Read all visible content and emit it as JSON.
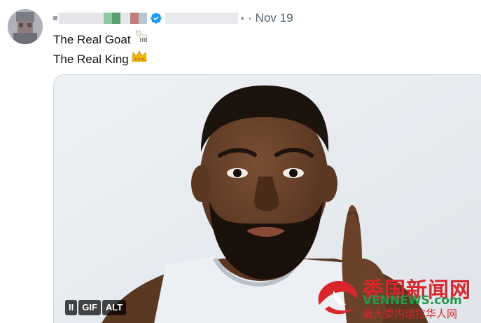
{
  "tweet": {
    "date_separator": "·",
    "date": "Nov 19",
    "lines": [
      "The Real Goat",
      "The Real King"
    ],
    "emojis": [
      "goat-emoji",
      "crown-emoji"
    ]
  },
  "media": {
    "controls": {
      "pause": "II",
      "gif": "GIF",
      "alt": "ALT"
    }
  },
  "watermark": {
    "title": "委国新闻网",
    "site": "VENNEWS.com",
    "subtitle": "最大委内瑞拉华人网"
  },
  "colors": {
    "text": "#0f1419",
    "muted": "#536471",
    "verified": "#1d9bf0",
    "watermark_red": "#d9262b",
    "watermark_green": "#1f9a4a"
  }
}
